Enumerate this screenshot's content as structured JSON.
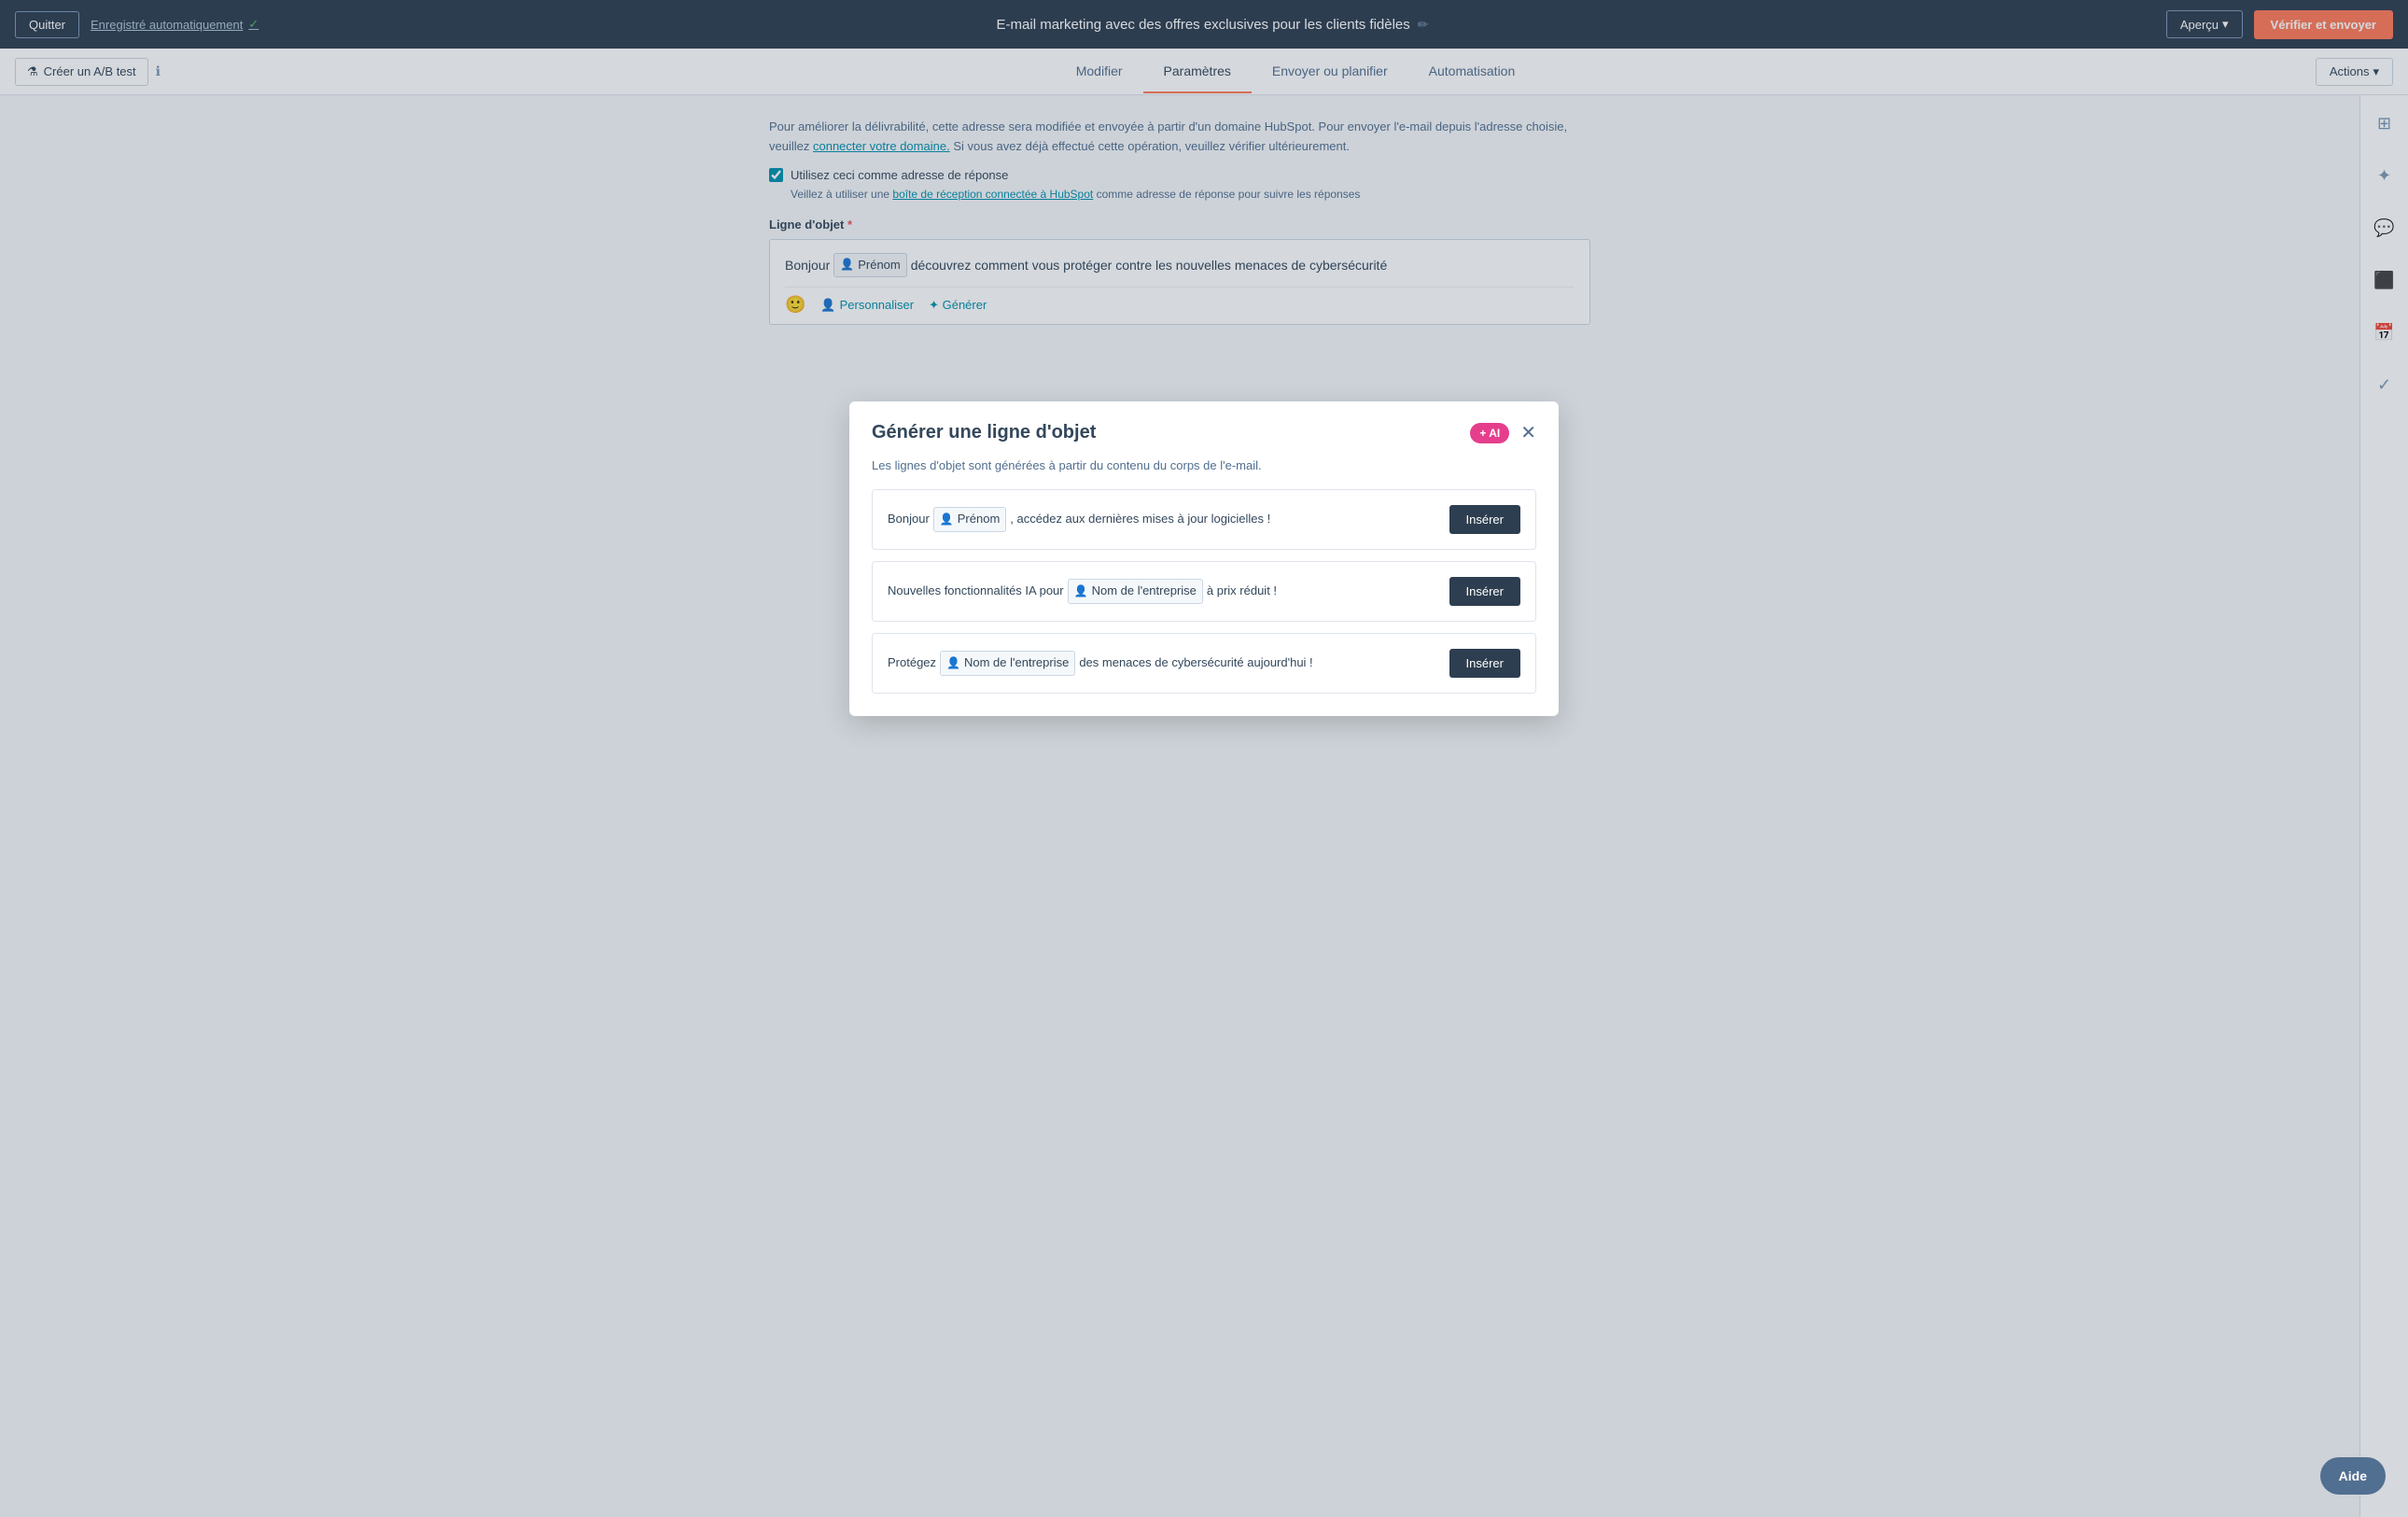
{
  "topbar": {
    "quit_label": "Quitter",
    "autosave_label": "Enregistré automatiquement",
    "autosave_check": "✓",
    "title": "E-mail marketing avec des offres exclusives pour les clients fidèles",
    "edit_icon": "✏",
    "preview_label": "Aperçu",
    "preview_chevron": "▾",
    "send_label": "Vérifier et envoyer"
  },
  "navbar": {
    "ab_test_label": "Créer un A/B test",
    "tabs": [
      {
        "id": "modifier",
        "label": "Modifier",
        "active": false
      },
      {
        "id": "parametres",
        "label": "Paramètres",
        "active": true
      },
      {
        "id": "envoyer",
        "label": "Envoyer ou planifier",
        "active": false
      },
      {
        "id": "automatisation",
        "label": "Automatisation",
        "active": false
      }
    ],
    "actions_label": "Actions",
    "actions_chevron": "▾"
  },
  "content": {
    "info_text_1": "Pour améliorer la délivrabilité, cette adresse sera modifiée et envoyée à partir d'un domaine HubSpot.",
    "info_text_1b": "Pour envoyer l'e-mail depuis l'adresse choisie, veuillez",
    "connect_domain_link": "connecter votre domaine.",
    "info_text_1c": "Si vous avez déjà effectué cette opération, veuillez vérifier ultérieurement.",
    "checkbox_label": "Utilisez ceci comme adresse de réponse",
    "inbox_text_1": "Veillez à utiliser une",
    "inbox_link": "boîte de réception connectée à HubSpot",
    "inbox_text_2": "comme adresse de réponse pour suivre les réponses",
    "subject_label": "Ligne d'objet",
    "required_star": "*",
    "subject_prefix": "Bonjour",
    "subject_token_1": "Prénom",
    "subject_suffix": "découvrez comment vous protéger contre les nouvelles menaces de cybersécurité",
    "subject_second_line": "cybersécurité",
    "toolbar_emoji": "🙂",
    "toolbar_personalize": "Personnaliser",
    "toolbar_generate": "✦ Générer"
  },
  "modal": {
    "title": "Générer une ligne d'objet",
    "ai_badge": "+ AI",
    "subtitle": "Les lignes d'objet sont générées à partir du contenu du corps de l'e-mail.",
    "suggestions": [
      {
        "prefix": "Bonjour",
        "token": "Prénom",
        "suffix": ", accédez aux dernières mises à jour logicielles !",
        "insert_label": "Insérer"
      },
      {
        "prefix": "Nouvelles fonctionnalités IA pour",
        "token": "Nom de l'entreprise",
        "suffix": "à prix réduit !",
        "insert_label": "Insérer"
      },
      {
        "prefix": "Protégez",
        "token": "Nom de l'entreprise",
        "suffix": "des menaces de cybersécurité aujourd'hui !",
        "insert_label": "Insérer"
      }
    ]
  },
  "sidebar_icons": {
    "grid": "⊞",
    "star": "✦",
    "chat": "💬",
    "screen": "⬜",
    "calendar": "📅",
    "check": "✓"
  },
  "help": {
    "label": "Aide"
  }
}
